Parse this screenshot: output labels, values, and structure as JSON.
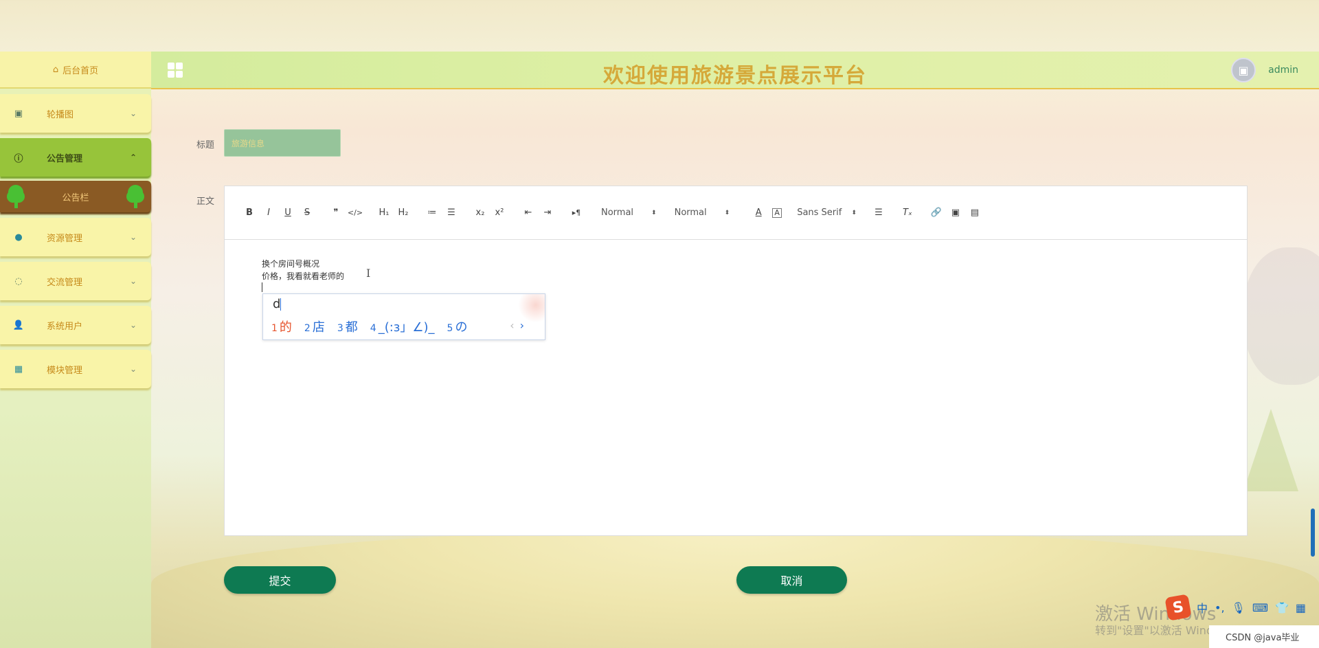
{
  "sidebar": {
    "home": "后台首页",
    "items": [
      {
        "label": "轮播图",
        "icon": "image-icon",
        "glyph": "▣"
      },
      {
        "label": "公告管理",
        "icon": "info-circle-icon",
        "glyph": "ⓘ"
      },
      {
        "label": "资源管理",
        "icon": "location-pin-icon",
        "glyph": "●"
      },
      {
        "label": "交流管理",
        "icon": "chat-bubble-icon",
        "glyph": "◌"
      },
      {
        "label": "系统用户",
        "icon": "user-icon",
        "glyph": "👤"
      },
      {
        "label": "模块管理",
        "icon": "grid-icon",
        "glyph": "▦"
      }
    ],
    "active_sub": "公告栏"
  },
  "header": {
    "title": "欢迎使用旅游景点展示平台",
    "username": "admin"
  },
  "form": {
    "title_label": "标题",
    "title_value": "旅游信息",
    "body_label": "正文",
    "content_lines": [
      "换个房间号概况",
      "价格，我看就看老师的"
    ]
  },
  "toolbar": {
    "buttons": [
      "B",
      "I",
      "U",
      "S",
      "❞",
      "</>",
      "H₁",
      "H₂",
      "≔",
      "☰",
      "x₂",
      "x²",
      "⇤",
      "⇥",
      "▸¶"
    ],
    "select_size": "Normal",
    "select_header": "Normal",
    "select_font": "Sans Serif"
  },
  "ime": {
    "input": "d",
    "candidates": [
      {
        "n": "1",
        "text": "的"
      },
      {
        "n": "2",
        "text": "店"
      },
      {
        "n": "3",
        "text": "都"
      },
      {
        "n": "4",
        "text": "_(:з」∠)_"
      },
      {
        "n": "5",
        "text": "の"
      }
    ]
  },
  "actions": {
    "submit": "提交",
    "cancel": "取消"
  },
  "watermark": {
    "line1": "激活 Windows",
    "line2": "转到\"设置\"以激活 Windows。"
  },
  "tray": {
    "lang": "中",
    "credit": "CSDN @java毕业"
  },
  "colors": {
    "accent": "#0e7a52",
    "active_menu": "#97c43a",
    "sub_menu": "#8a5a24",
    "title": "#d5a93a"
  }
}
